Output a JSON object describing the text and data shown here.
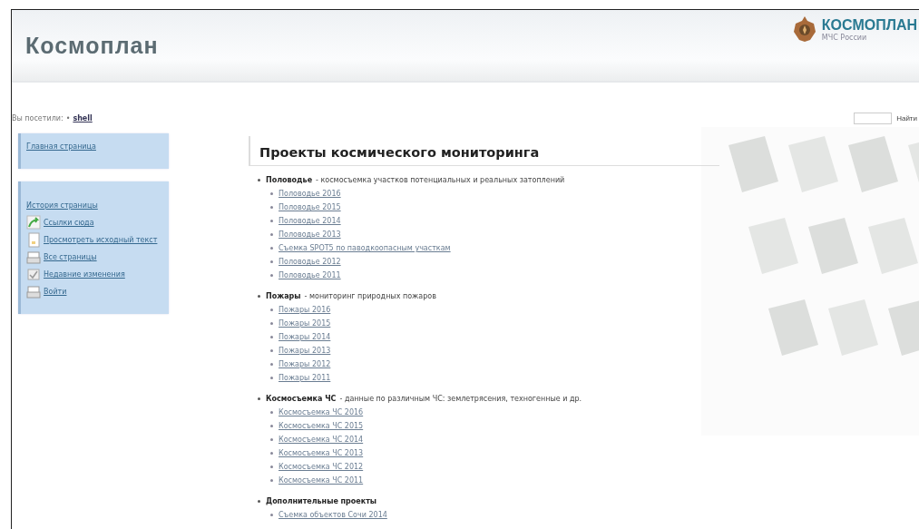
{
  "header": {
    "site_title": "Космоплан",
    "logo_title": "КОСМОПЛАН",
    "logo_subtitle": "МЧС России"
  },
  "breadcrumb": {
    "label": "Вы посетили:",
    "separator": "•",
    "link": "shell"
  },
  "search": {
    "button": "Найти"
  },
  "sidebar": [
    {
      "items": [
        {
          "kind": "plain",
          "label": "Главная страница"
        }
      ]
    },
    {
      "items": [
        {
          "kind": "plain",
          "label": "История страницы"
        },
        {
          "kind": "arrow",
          "label": "Ссылки сюда"
        },
        {
          "kind": "document",
          "label": "Просмотреть исходный текст"
        },
        {
          "kind": "tray",
          "label": "Все страницы"
        },
        {
          "kind": "check",
          "label": "Недавние изменения"
        },
        {
          "kind": "tray",
          "label": "Войти"
        }
      ]
    }
  ],
  "content": {
    "title": "Проекты космического мониторинга",
    "sections": [
      {
        "title": "Половодье",
        "description": "- космосъемка участков потенциальных и реальных затоплений",
        "links": [
          "Половодье 2016",
          "Половодье 2015",
          "Половодье 2014",
          "Половодье 2013",
          "Съемка SPOT5 по паводкоопасным участкам",
          "Половодье 2012",
          "Половодье 2011"
        ]
      },
      {
        "title": "Пожары",
        "description": "- мониторинг природных пожаров",
        "links": [
          "Пожары 2016",
          "Пожары 2015",
          "Пожары 2014",
          "Пожары 2013",
          "Пожары 2012",
          "Пожары 2011"
        ]
      },
      {
        "title": "Космосъемка ЧС",
        "description": "- данные по различным ЧС: землетрясения, техногенные и др.",
        "links": [
          "Космосъемка ЧС 2016",
          "Космосъемка ЧС 2015",
          "Космосъемка ЧС 2014",
          "Космосъемка ЧС 2013",
          "Космосъемка ЧС 2012",
          "Космосъемка ЧС 2011"
        ]
      },
      {
        "title": "Дополнительные проекты",
        "links": [
          "Съемка объектов Сочи 2014"
        ]
      }
    ]
  }
}
